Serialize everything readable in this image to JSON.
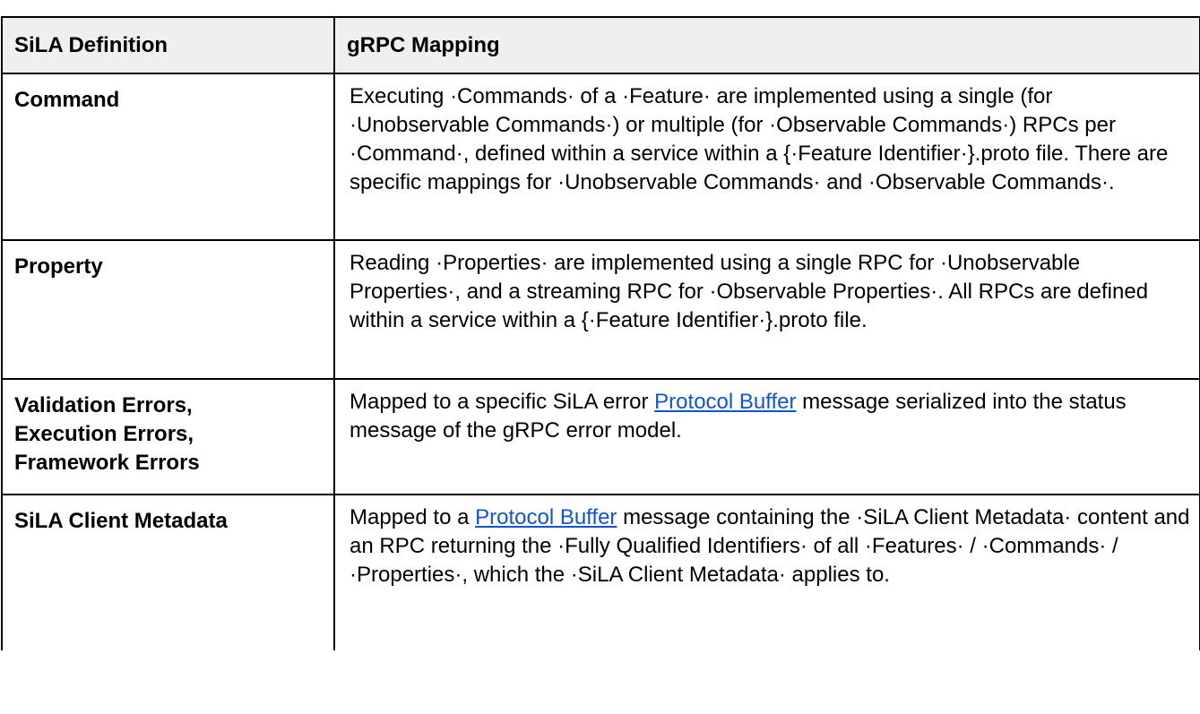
{
  "table": {
    "headers": [
      "SiLA Definition",
      "gRPC Mapping"
    ],
    "rows": [
      {
        "definition": "Command",
        "mapping": "Executing ·Commands· of a ·Feature· are implemented using a single (for ·Unobservable Commands·) or multiple (for ·Observable Commands·) RPCs per ·Command·, defined within a service within a {·Feature Identifier·}.proto file. There are specific mappings for ·Unobservable Commands· and ·Observable Commands·."
      },
      {
        "definition": "Property",
        "mapping": "Reading ·Properties· are implemented using a single RPC for ·Unobservable Properties·, and a streaming RPC for ·Observable Properties·. All RPCs are defined within a service within a {·Feature Identifier·}.proto file."
      },
      {
        "definition": "Validation Errors, Execution Errors, Framework Errors",
        "mapping_before": "Mapped to a specific SiLA error ",
        "mapping_link": "Protocol Buffer",
        "mapping_after": " message serialized into the status message of the gRPC error model."
      },
      {
        "definition": "SiLA Client Metadata",
        "mapping_before": "Mapped to a ",
        "mapping_link": "Protocol Buffer",
        "mapping_after": " message containing the ·SiLA Client Metadata· content and an RPC returning the ·Fully Qualified Identifiers· of all ·Features· / ·Commands· / ·Properties·, which the ·SiLA Client Metadata· applies to."
      }
    ]
  },
  "colors": {
    "header_background": "#efefef",
    "border": "#000000",
    "link": "#1155cc"
  }
}
